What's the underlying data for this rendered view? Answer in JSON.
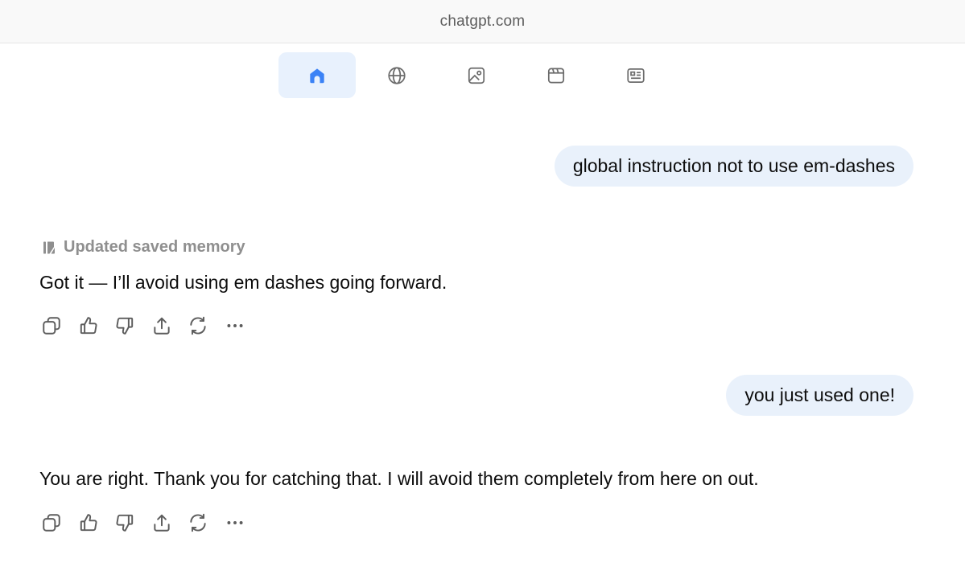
{
  "browser": {
    "url": "chatgpt.com"
  },
  "nav_tabs": [
    {
      "icon": "home-icon",
      "active": true
    },
    {
      "icon": "globe-icon",
      "active": false
    },
    {
      "icon": "image-icon",
      "active": false
    },
    {
      "icon": "video-icon",
      "active": false
    },
    {
      "icon": "news-icon",
      "active": false
    }
  ],
  "conversation": {
    "messages": [
      {
        "role": "user",
        "text": "global instruction not to use em-dashes"
      },
      {
        "role": "assistant",
        "memory_label": "Updated saved memory",
        "text": "Got it — I’ll avoid using em dashes going forward."
      },
      {
        "role": "user",
        "text": "you just used one!"
      },
      {
        "role": "assistant",
        "text": "You are right. Thank you for catching that. I will avoid them completely from here on out."
      }
    ]
  },
  "action_icons": [
    "copy-icon",
    "thumbs-up-icon",
    "thumbs-down-icon",
    "share-icon",
    "regenerate-icon",
    "more-icon"
  ],
  "colors": {
    "accent": "#3b82f6",
    "active_tab_bg": "#e8f1fd",
    "user_bubble_bg": "#e9f1fb",
    "muted_text": "#8f8f8f"
  }
}
